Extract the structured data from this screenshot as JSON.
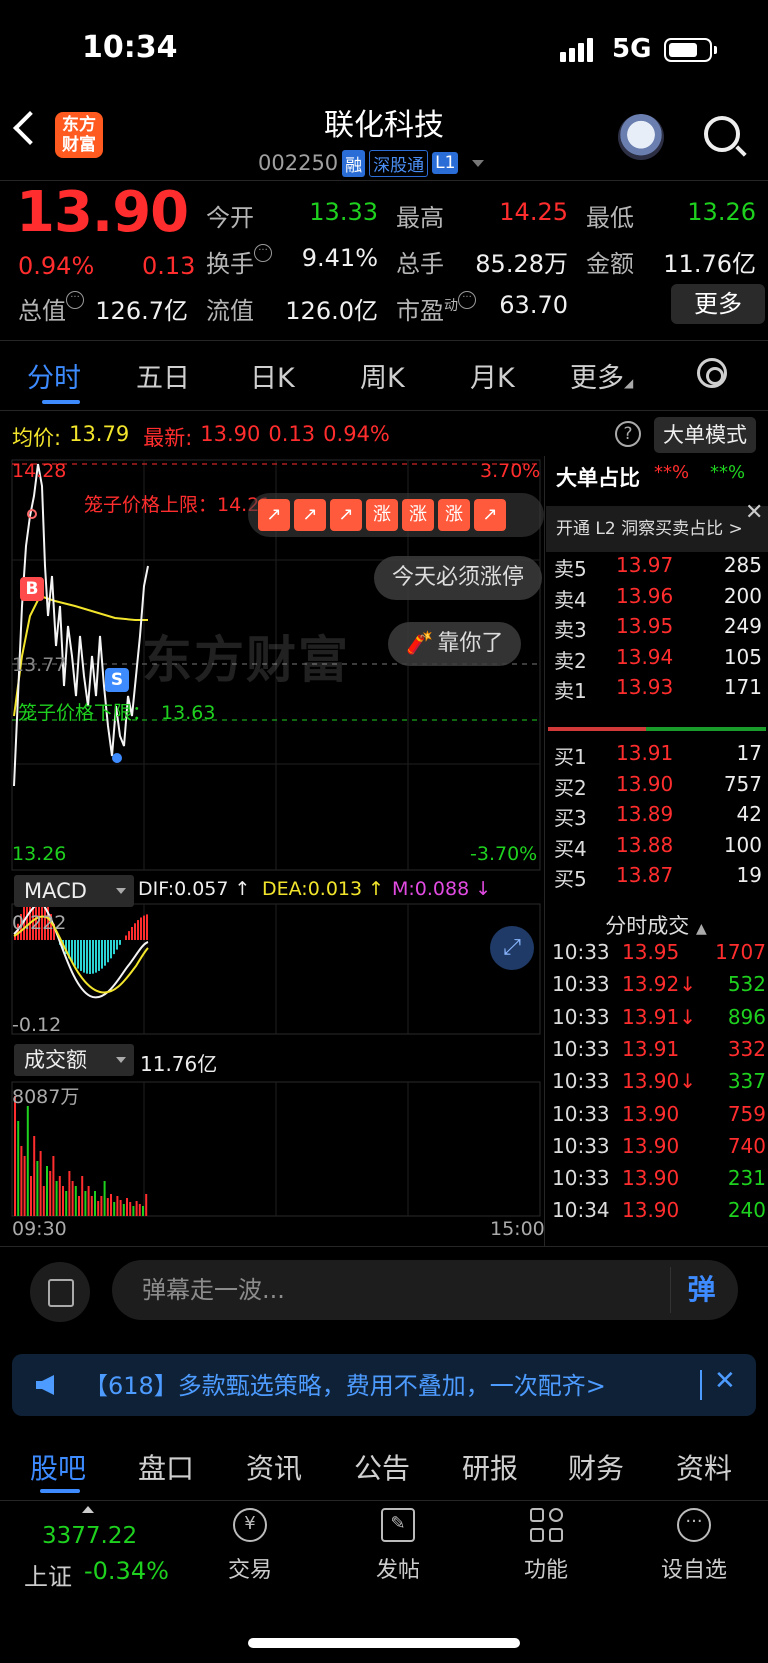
{
  "status_bar": {
    "time": "10:34",
    "network": "5G"
  },
  "header": {
    "logo_text_1": "东方",
    "logo_text_2": "财富",
    "stock_name": "联化科技",
    "stock_code": "002250",
    "tags": [
      "融",
      "深股通",
      "L1"
    ]
  },
  "quote": {
    "price": "13.90",
    "change_pct": "0.94%",
    "change": "0.13",
    "fields": {
      "open_label": "今开",
      "open": "13.33",
      "high_label": "最高",
      "high": "14.25",
      "low_label": "最低",
      "low": "13.26",
      "turnover_label": "换手",
      "turnover": "9.41%",
      "volume_label": "总手",
      "volume": "85.28万",
      "amount_label": "金额",
      "amount": "11.76亿",
      "mktcap_label": "总值",
      "mktcap": "126.7亿",
      "float_label": "流值",
      "float": "126.0亿",
      "pe_label": "市盈",
      "pe_sup": "动",
      "pe": "63.70"
    },
    "more_button": "更多"
  },
  "tabs": [
    "分时",
    "五日",
    "日K",
    "周K",
    "月K",
    "更多"
  ],
  "chart_header": {
    "avg_label": "均价:",
    "avg_value": "13.79",
    "last_label": "最新:",
    "last_value": "13.90",
    "last_change": "0.13",
    "last_pct": "0.94%",
    "big_order_button": "大单模式",
    "help": "?"
  },
  "chart_labels": {
    "high_price": "14.28",
    "high_pct": "3.70%",
    "low_price": "13.26",
    "low_pct": "-3.70%",
    "mid_price": "13.77",
    "upper_limit": "笼子价格上限：14.21",
    "lower_limit_text": "笼子价格下限：",
    "lower_limit_value": "13.63",
    "marker_b": "B",
    "marker_s": "S",
    "watermark": "东方财富",
    "rise_chip": "涨",
    "bubble_1": "今天必须涨停",
    "bubble_2": "靠你了",
    "time_start": "09:30",
    "time_end": "15:00"
  },
  "macd": {
    "selector": "MACD",
    "dif": "DIF:0.057 ↑",
    "dea": "DEA:0.013 ↑",
    "m": "M:0.088 ↓",
    "top": "0.222",
    "bottom": "-0.12"
  },
  "volume": {
    "selector": "成交额",
    "total": "11.76亿",
    "max": "8087万"
  },
  "right_panel": {
    "title": "大单占比",
    "sell_pct": "**%",
    "buy_pct": "**%",
    "l2_promo": "开通 L2 洞察买卖占比 >",
    "close": "✕",
    "asks": [
      {
        "label": "卖5",
        "price": "13.97",
        "vol": "285"
      },
      {
        "label": "卖4",
        "price": "13.96",
        "vol": "200"
      },
      {
        "label": "卖3",
        "price": "13.95",
        "vol": "249"
      },
      {
        "label": "卖2",
        "price": "13.94",
        "vol": "105"
      },
      {
        "label": "卖1",
        "price": "13.93",
        "vol": "171"
      }
    ],
    "bids": [
      {
        "label": "买1",
        "price": "13.91",
        "vol": "17"
      },
      {
        "label": "买2",
        "price": "13.90",
        "vol": "757"
      },
      {
        "label": "买3",
        "price": "13.89",
        "vol": "42"
      },
      {
        "label": "买4",
        "price": "13.88",
        "vol": "100"
      },
      {
        "label": "买5",
        "price": "13.87",
        "vol": "19"
      }
    ],
    "trades_title": "分时成交",
    "trades": [
      {
        "time": "10:33",
        "price": "13.95",
        "vol": "1707",
        "dir": "buy"
      },
      {
        "time": "10:33",
        "price": "13.92↓",
        "vol": "532",
        "dir": "sell"
      },
      {
        "time": "10:33",
        "price": "13.91↓",
        "vol": "896",
        "dir": "sell"
      },
      {
        "time": "10:33",
        "price": "13.91",
        "vol": "332",
        "dir": "buy"
      },
      {
        "time": "10:33",
        "price": "13.90↓",
        "vol": "337",
        "dir": "sell"
      },
      {
        "time": "10:33",
        "price": "13.90",
        "vol": "759",
        "dir": "buy"
      },
      {
        "time": "10:33",
        "price": "13.90",
        "vol": "740",
        "dir": "buy"
      },
      {
        "time": "10:33",
        "price": "13.90",
        "vol": "231",
        "dir": "sell"
      },
      {
        "time": "10:34",
        "price": "13.90",
        "vol": "240",
        "dir": "sell"
      }
    ]
  },
  "danmaku": {
    "placeholder": "弹幕走一波...",
    "send": "弹"
  },
  "ad": {
    "text": "【618】多款甄选策略，费用不叠加，一次配齐>",
    "close": "✕"
  },
  "bottom_tabs": [
    "股吧",
    "盘口",
    "资讯",
    "公告",
    "研报",
    "财务",
    "资料"
  ],
  "bottom_nav": {
    "index_value": "3377.22",
    "index_name": "上证",
    "index_change": "-0.34%",
    "items": [
      "交易",
      "发帖",
      "功能",
      "设自选"
    ],
    "item_icons": [
      "yuan-exchange-icon",
      "edit-icon",
      "grid-icon",
      "more-dots-icon"
    ]
  },
  "colors": {
    "up": "#ff2d2d",
    "down": "#1fd11f",
    "accent": "#3d8bff",
    "avg_line": "#f2e52c"
  }
}
